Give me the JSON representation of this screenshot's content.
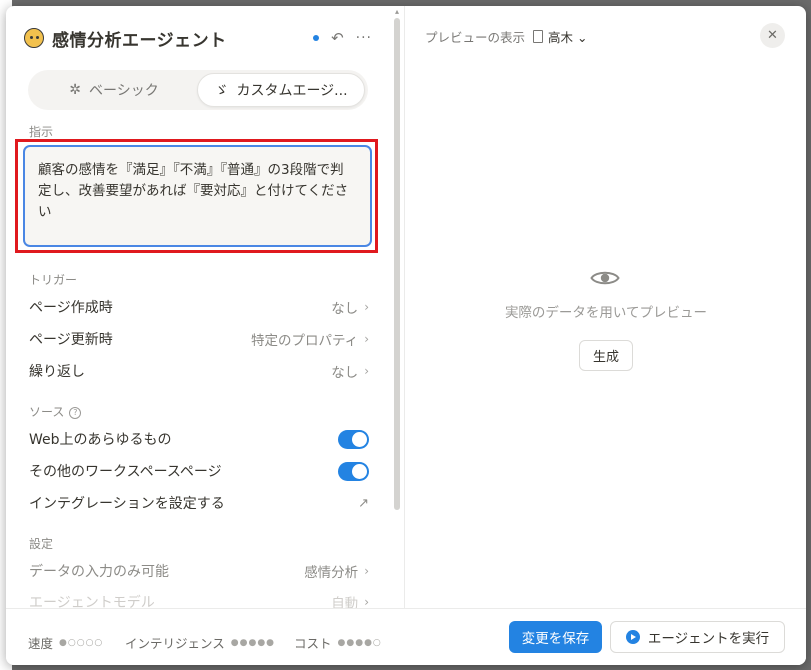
{
  "header": {
    "title": "感情分析エージェント"
  },
  "tabs": [
    {
      "label": "ベーシック",
      "active": false
    },
    {
      "label": "カスタムエージ...",
      "active": true
    }
  ],
  "instructions": {
    "label": "指示",
    "text": "顧客の感情を『満足』『不満』『普通』の3段階で判定し、改善要望があれば『要対応』と付けてください"
  },
  "triggers": {
    "label": "トリガー",
    "items": [
      {
        "label": "ページ作成時",
        "value": "なし"
      },
      {
        "label": "ページ更新時",
        "value": "特定のプロパティ"
      },
      {
        "label": "繰り返し",
        "value": "なし"
      }
    ]
  },
  "sources": {
    "label": "ソース",
    "items": [
      {
        "label": "Web上のあらゆるもの",
        "enabled": true
      },
      {
        "label": "その他のワークスペースページ",
        "enabled": true
      }
    ],
    "integration_label": "インテグレーションを設定する"
  },
  "settings": {
    "label": "設定",
    "items": [
      {
        "label": "データの入力のみ可能",
        "value": "感情分析"
      },
      {
        "label": "エージェントモデル",
        "value": "自動"
      }
    ]
  },
  "footer": {
    "speed_label": "速度",
    "speed_level": 1,
    "intelligence_label": "インテリジェンス",
    "intelligence_level": 5,
    "cost_label": "コスト",
    "cost_level": 4,
    "save_label": "変更を保存",
    "run_label": "エージェントを実行"
  },
  "preview": {
    "heading": "プレビューの表示",
    "user": "高木",
    "message": "実際のデータを用いてプレビュー",
    "generate_label": "生成"
  },
  "colors": {
    "accent": "#2383e2",
    "highlight_outline": "#e0191e"
  }
}
